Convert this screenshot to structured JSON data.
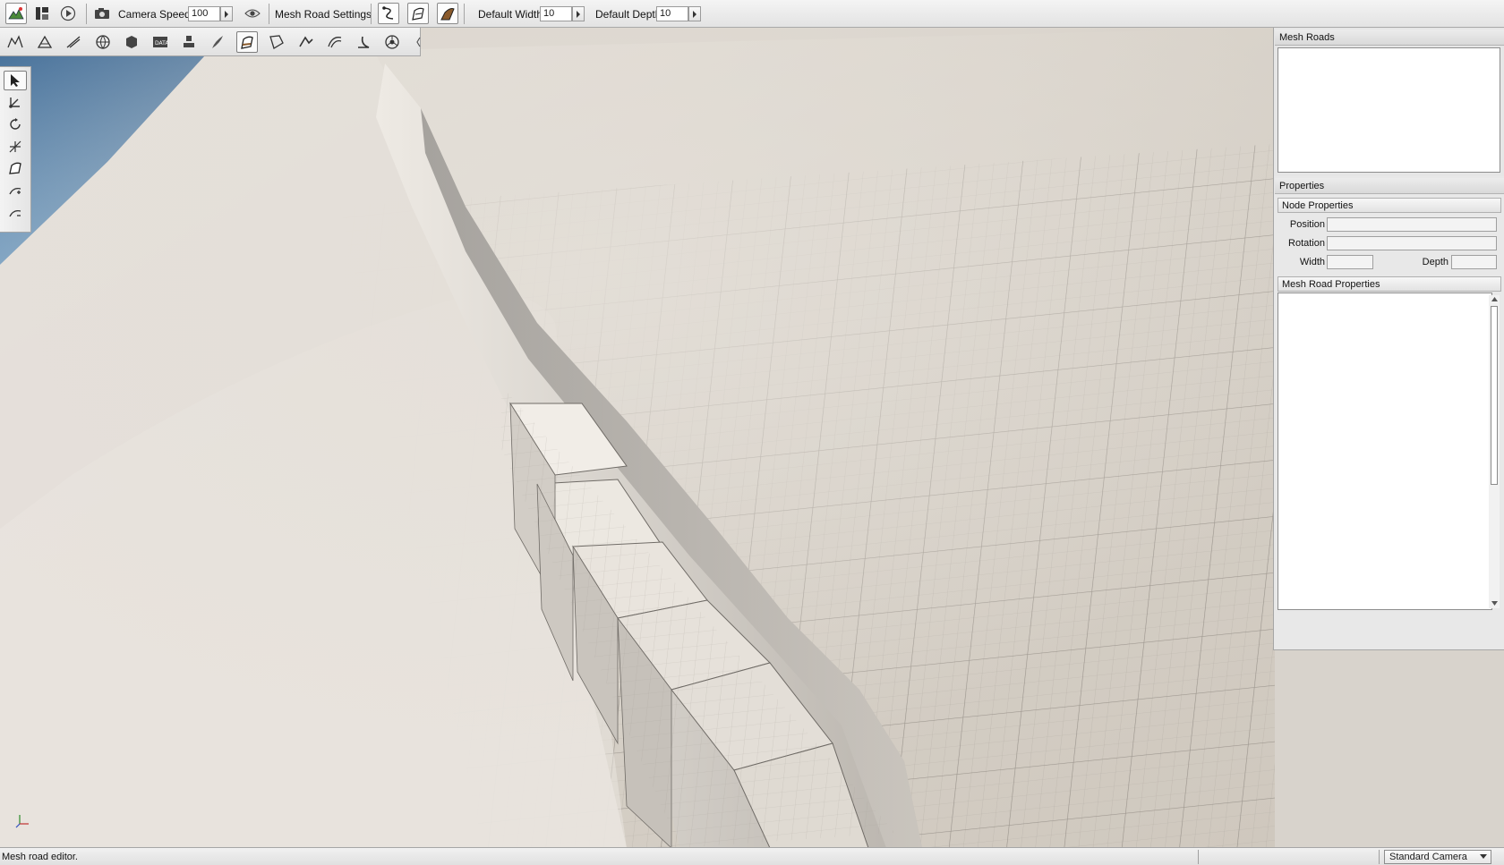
{
  "toolbar": {
    "camera_speed_label": "Camera Speed",
    "camera_speed_value": "100",
    "settings_label": "Mesh Road Settings",
    "default_width_label": "Default Width",
    "default_width_value": "10",
    "default_depth_label": "Default Depth",
    "default_depth_value": "10",
    "icons": [
      "world-editor-icon",
      "layout-icon",
      "play-icon",
      "camera-icon",
      "visibility-eye-icon",
      "road-select-icon",
      "road-add-icon",
      "road-paint-icon"
    ]
  },
  "palette": {
    "active_index": 8,
    "tools": [
      "terrain-editor-icon",
      "terrain-painter-icon",
      "road-editor-icon",
      "forest-editor-icon",
      "object-editor-icon",
      "datablock-editor-icon",
      "decal-editor-icon",
      "river-editor-icon",
      "mesh-road-editor-icon",
      "convex-editor-icon",
      "navmesh-editor-icon",
      "particle-editor-icon",
      "shape-editor-icon",
      "material-editor-icon"
    ]
  },
  "vertical_tools": {
    "active_index": 0,
    "tools": [
      "select-arrow-icon",
      "move-node-icon",
      "rotate-node-icon",
      "scale-node-icon",
      "add-road-icon",
      "insert-node-icon",
      "remove-node-icon"
    ]
  },
  "panels": {
    "mesh_roads_title": "Mesh Roads",
    "properties_title": "Properties",
    "node_properties_title": "Node Properties",
    "position_label": "Position",
    "rotation_label": "Rotation",
    "width_label": "Width",
    "depth_label": "Depth",
    "mesh_road_properties_title": "Mesh Road Properties"
  },
  "statusbar": {
    "message": "Mesh road editor.",
    "camera_mode": "Standard Camera"
  },
  "colors": {
    "sky": "#3e6f9e",
    "terrain": "#dcd6ce",
    "grid_line": "#8f8a84",
    "active_tool_icon": "#8a5a2b"
  }
}
